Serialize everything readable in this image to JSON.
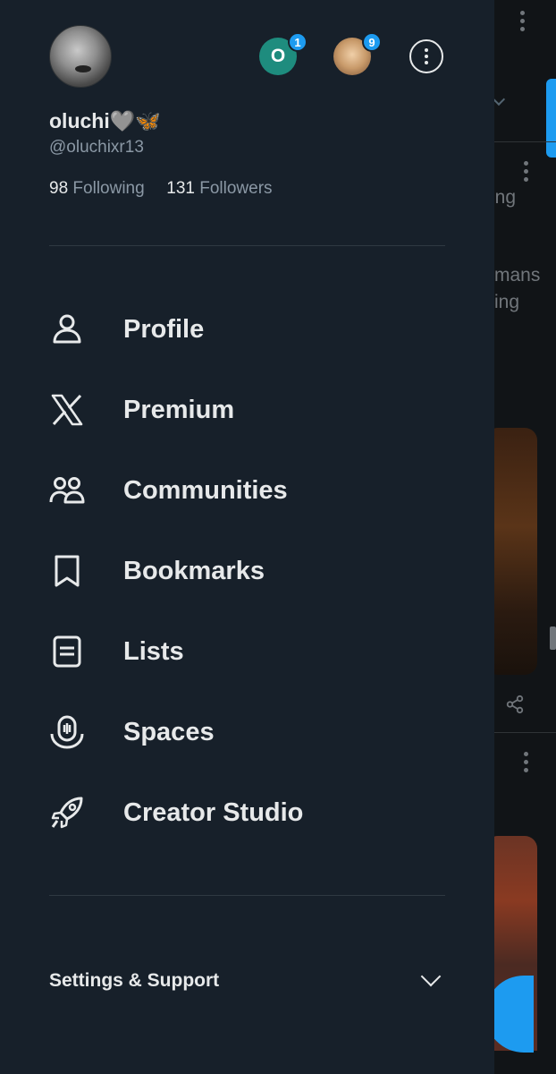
{
  "profile": {
    "name": "oluchi🩶🦋",
    "handle": "@oluchixr13",
    "following_count": "98",
    "following_label": "Following",
    "followers_count": "131",
    "followers_label": "Followers"
  },
  "accounts": [
    {
      "initial": "O",
      "badge": "1",
      "color": "#1e8c7e"
    },
    {
      "initial": "",
      "badge": "9",
      "color": "#c89a6a"
    }
  ],
  "menu": [
    {
      "label": "Profile",
      "icon": "person-icon"
    },
    {
      "label": "Premium",
      "icon": "x-logo-icon"
    },
    {
      "label": "Communities",
      "icon": "people-icon"
    },
    {
      "label": "Bookmarks",
      "icon": "bookmark-icon"
    },
    {
      "label": "Lists",
      "icon": "list-icon"
    },
    {
      "label": "Spaces",
      "icon": "microphone-icon"
    },
    {
      "label": "Creator Studio",
      "icon": "rocket-icon"
    }
  ],
  "settings": {
    "label": "Settings & Support",
    "icon": "chevron-down-icon"
  },
  "background_feed": {
    "fragments": [
      "ing",
      "mans",
      "ing"
    ]
  },
  "colors": {
    "drawer_bg": "#17202a",
    "accent": "#1d9bf0",
    "text_primary": "#e7e9ea",
    "text_secondary": "#8b98a5"
  }
}
